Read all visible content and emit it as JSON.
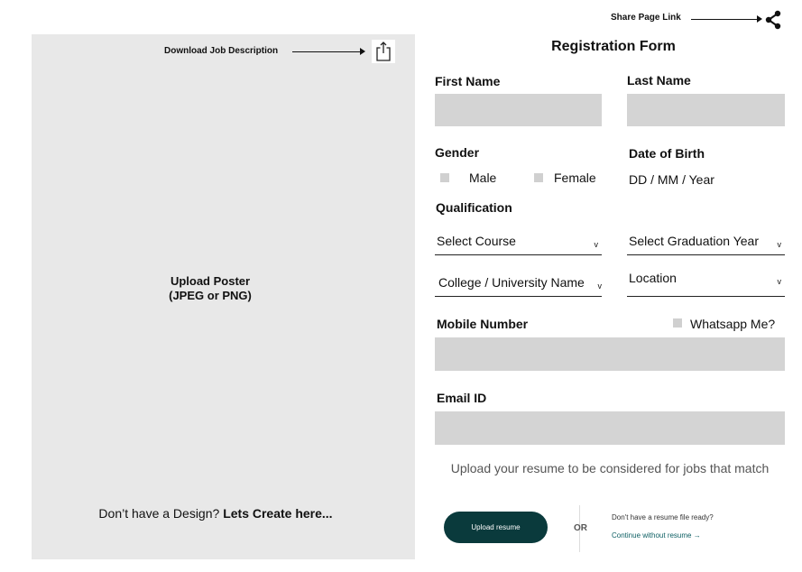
{
  "share": {
    "label": "Share Page Link",
    "icon": "share-icon"
  },
  "poster": {
    "download_label": "Download Job Description",
    "download_icon": "upload-share-icon",
    "upload_line1": "Upload Poster",
    "upload_line2": "(JPEG or PNG)",
    "design_prefix": "Don’t have a Design?",
    "design_link": "Lets Create here..."
  },
  "form": {
    "title": "Registration Form",
    "first_name_label": "First Name",
    "last_name_label": "Last Name",
    "gender_label": "Gender",
    "gender_options": [
      "Male",
      "Female"
    ],
    "dob_label": "Date of Birth",
    "dob_placeholder": "DD / MM / Year",
    "qualification_label": "Qualification",
    "course_select": "Select Course",
    "grad_year_select": "Select Graduation Year",
    "college_select": "College / University Name",
    "location_select": "Location",
    "chevron_glyph": "v",
    "mobile_label": "Mobile Number",
    "whatsapp_label": "Whatsapp Me?",
    "email_label": "Email ID",
    "resume_prompt": "Upload your resume to be considered for jobs that match",
    "upload_resume_button": "Upload resume",
    "or_text": "OR",
    "no_resume_text": "Don't have a resume file ready?",
    "continue_link": "Continue without resume →"
  }
}
